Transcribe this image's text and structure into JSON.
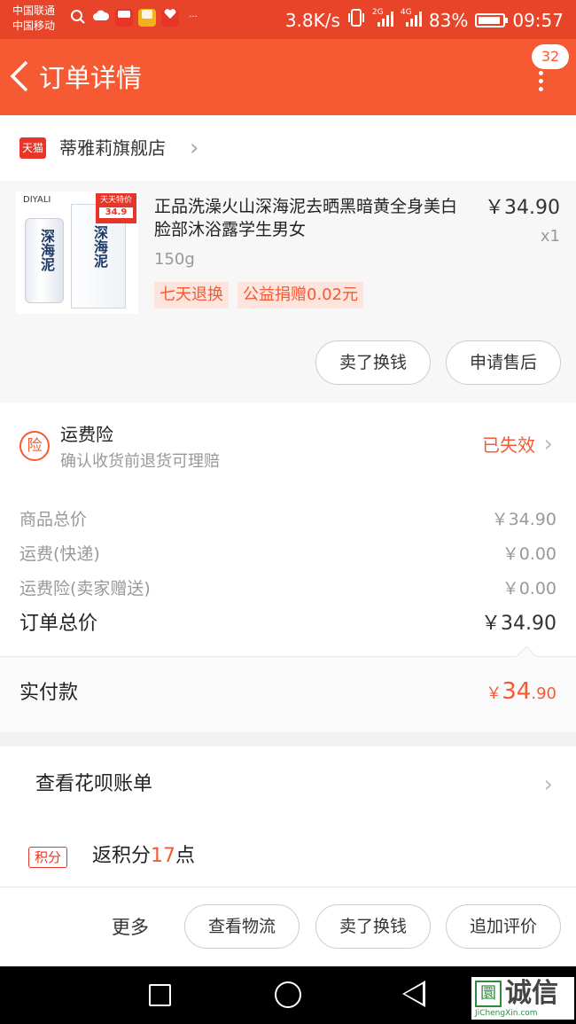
{
  "status_bar": {
    "carrier1": "中国联通",
    "carrier2": "中国移动",
    "speed": "3.8K/s",
    "net1": "2G",
    "net2": "4G",
    "battery": "83%",
    "time": "09:57"
  },
  "navbar": {
    "back_glyph": "〈",
    "title": "订单详情",
    "badge_count": "32"
  },
  "store": {
    "logo_text": "天猫",
    "name": "蒂雅莉旗舰店",
    "chevron": "›"
  },
  "product": {
    "thumb_brand": "DIYALI",
    "thumb_deal": "天天特价",
    "thumb_deal_price": "34.9",
    "thumb_glyph": "深海泥",
    "title": "正品洗澡火山深海泥去晒黑暗黄全身美白脸部沐浴露学生男女",
    "price": "￥34.90",
    "qty": "x1",
    "spec": "150g",
    "tags": [
      "七天退换",
      "公益捐赠0.02元"
    ],
    "buttons": {
      "sell": "卖了换钱",
      "after_sale": "申请售后"
    }
  },
  "insurance": {
    "icon_text": "险",
    "title": "运费险",
    "subtitle": "确认收货前退货可理赔",
    "status": "已失效",
    "chevron": "›"
  },
  "summary": {
    "rows": [
      {
        "label": "商品总价",
        "value": "￥34.90"
      },
      {
        "label": "运费(快递)",
        "value": "￥0.00"
      },
      {
        "label": "运费险(卖家赠送)",
        "value": "￥0.00"
      }
    ],
    "total_label": "订单总价",
    "total_value": "￥34.90"
  },
  "payment": {
    "label": "实付款",
    "currency": "￥",
    "amount_int": "34",
    "amount_dec": ".90"
  },
  "huabei": {
    "label": "查看花呗账单",
    "chevron": "›"
  },
  "points": {
    "icon_text": "积分",
    "prefix": "返积分",
    "count": "17",
    "suffix": "点"
  },
  "actions": {
    "more": "更多",
    "logistics": "查看物流",
    "sell": "卖了换钱",
    "review": "追加评价"
  },
  "watermark": {
    "box": "圜",
    "text": "诚信",
    "sub": "JiChengXin.com"
  },
  "colors": {
    "accent": "#f55a33",
    "status_bar": "#e8442a",
    "tmall_red": "#e8352a"
  }
}
